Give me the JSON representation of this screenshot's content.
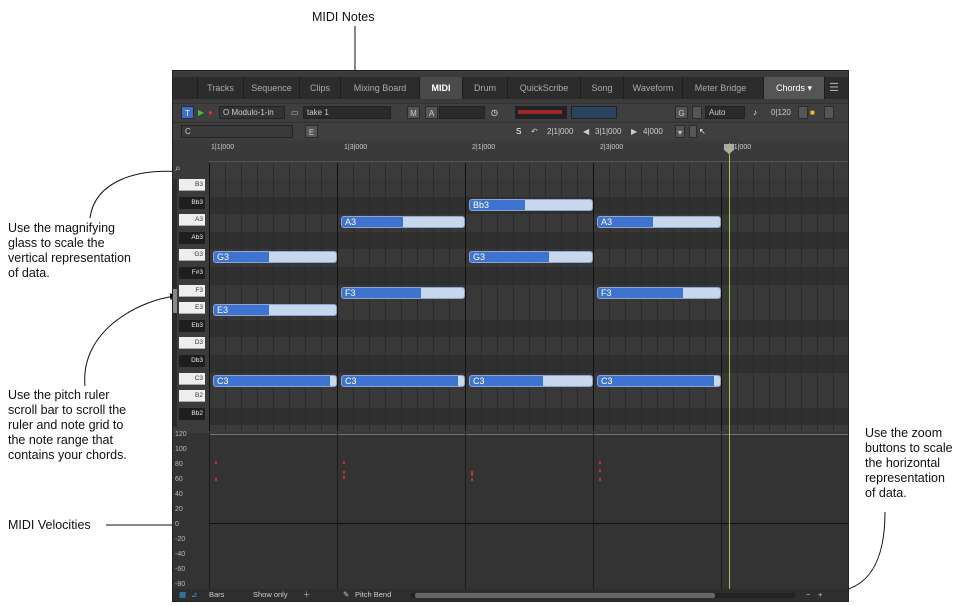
{
  "annotations": {
    "midi_notes": "MIDI Notes",
    "magnifier": [
      "Use the magnifying",
      "glass to scale the",
      "vertical representation",
      "of data."
    ],
    "scrollbar": [
      "Use the pitch ruler",
      "scroll bar to scroll the",
      "ruler and note grid to",
      "the note range that",
      "contains your chords."
    ],
    "velocities": "MIDI Velocities",
    "zoom": [
      "Use the zoom",
      "buttons to scale",
      "the horizontal",
      "representation",
      "of data."
    ]
  },
  "tabs": [
    "Tracks",
    "Sequence",
    "Clips",
    "Mixing Board",
    "MIDI",
    "Drum",
    "QuickScribe",
    "Song",
    "Waveform",
    "Meter Bridge",
    "Chords"
  ],
  "active_tab": "MIDI",
  "toolbar1": {
    "t_btn": "T",
    "input": "O Modulo-1-in",
    "take": "take 1",
    "m_btn": "M",
    "a_btn": "A",
    "g_btn": "G",
    "auto": "Auto",
    "counter": "0|120"
  },
  "toolbar2": {
    "c_field": "C",
    "e_btn": "E",
    "s_btn": "S",
    "pos1": "2|1|000",
    "pos2": "3|1|000",
    "pos3": "4|000"
  },
  "ruler": [
    "1|1|000",
    "1|3|000",
    "2|1|000",
    "2|3|000",
    "3|1|000"
  ],
  "keys": [
    "B3",
    "Bb3",
    "A3",
    "Ab3",
    "G3",
    "F#3",
    "F3",
    "E3",
    "Eb3",
    "D3",
    "Db3",
    "C3",
    "B2",
    "Bb2"
  ],
  "notes": [
    {
      "label": "Bb3",
      "pitch": "Bb3",
      "start": 2,
      "length": 1,
      "velocity": 0.45
    },
    {
      "label": "A3",
      "pitch": "A3",
      "start": 1,
      "length": 1,
      "velocity": 0.5
    },
    {
      "label": "A3",
      "pitch": "A3",
      "start": 3,
      "length": 1,
      "velocity": 0.45
    },
    {
      "label": "G3",
      "pitch": "G3",
      "start": 0,
      "length": 1,
      "velocity": 0.45
    },
    {
      "label": "G3",
      "pitch": "G3",
      "start": 2,
      "length": 1,
      "velocity": 0.65
    },
    {
      "label": "F3",
      "pitch": "F3",
      "start": 1,
      "length": 1,
      "velocity": 0.65
    },
    {
      "label": "F3",
      "pitch": "F3",
      "start": 3,
      "length": 1,
      "velocity": 0.7
    },
    {
      "label": "E3",
      "pitch": "E3",
      "start": 0,
      "length": 1,
      "velocity": 0.45
    },
    {
      "label": "C3",
      "pitch": "C3",
      "start": 0,
      "length": 1,
      "velocity": 0.95
    },
    {
      "label": "C3",
      "pitch": "C3",
      "start": 1,
      "length": 1,
      "velocity": 0.95
    },
    {
      "label": "C3",
      "pitch": "C3",
      "start": 2,
      "length": 1,
      "velocity": 0.6
    },
    {
      "label": "C3",
      "pitch": "C3",
      "start": 3,
      "length": 1,
      "velocity": 0.95
    }
  ],
  "velocity_scale": [
    "120",
    "100",
    "80",
    "60",
    "40",
    "20",
    "0",
    "-20",
    "-40",
    "-60",
    "-80"
  ],
  "bottom": {
    "bars": "Bars",
    "show_only": "Show only",
    "pitch_bend": "Pitch Bend"
  },
  "colors": {
    "note_fill": "#3e73cf",
    "note_body": "#c7d7ee",
    "playhead": "#9ec84a",
    "accent_blue": "#3a6fd1"
  }
}
